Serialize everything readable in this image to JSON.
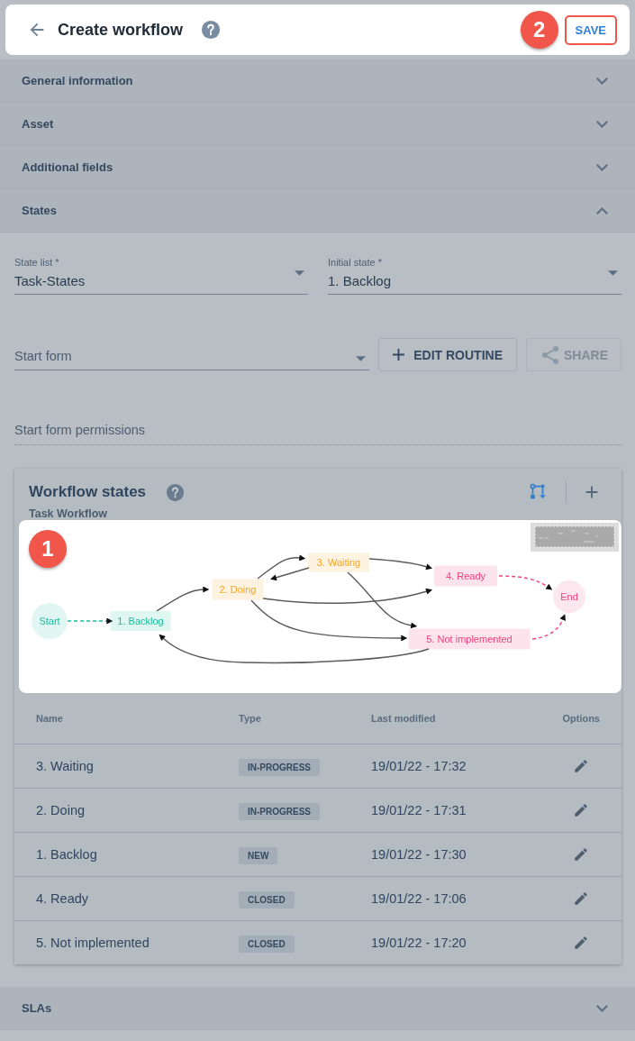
{
  "header": {
    "title": "Create workflow",
    "callout": "2",
    "save_label": "SAVE"
  },
  "sections": [
    {
      "title": "General information",
      "expanded": false
    },
    {
      "title": "Asset",
      "expanded": false
    },
    {
      "title": "Additional fields",
      "expanded": false
    },
    {
      "title": "States",
      "expanded": true,
      "content": {
        "selects": [
          {
            "label": "State list *",
            "value": "Task-States"
          },
          {
            "label": "Initial state *",
            "value": "1. Backlog"
          }
        ],
        "start_form": {
          "placeholder": "Start form"
        },
        "buttons": [
          {
            "label": "EDIT ROUTINE",
            "kind": "add",
            "disabled": false
          },
          {
            "label": "SHARE",
            "kind": "share",
            "disabled": true
          }
        ],
        "permissions": {
          "placeholder": "Start form permissions"
        },
        "card": {
          "title": "Workflow states",
          "subtitle": "Task Workflow",
          "diagram": {
            "callout": "1",
            "nodes": [
              {
                "label": "Start",
                "kind": "circle",
                "color": "#1abc9c"
              },
              {
                "label": "1. Backlog",
                "kind": "box",
                "color": "#1abc9c"
              },
              {
                "label": "2. Doing",
                "kind": "box",
                "color": "#f5a623"
              },
              {
                "label": "3. Waiting",
                "kind": "box",
                "color": "#f5a623"
              },
              {
                "label": "4. Ready",
                "kind": "box",
                "color": "#f0427a"
              },
              {
                "label": "5. Not implemented",
                "kind": "box",
                "color": "#f0427a"
              },
              {
                "label": "End",
                "kind": "circle",
                "color": "#f0427a"
              }
            ]
          },
          "columns": [
            "Name",
            "Type",
            "Last modified",
            "Options"
          ],
          "rows": [
            {
              "name": "3. Waiting",
              "type": "IN-PROGRESS",
              "modified": "19/01/22 - 17:32"
            },
            {
              "name": "2. Doing",
              "type": "IN-PROGRESS",
              "modified": "19/01/22 - 17:31"
            },
            {
              "name": "1. Backlog",
              "type": "NEW",
              "modified": "19/01/22 - 17:30"
            },
            {
              "name": "4. Ready",
              "type": "CLOSED",
              "modified": "19/01/22 - 17:06"
            },
            {
              "name": "5. Not implemented",
              "type": "CLOSED",
              "modified": "19/01/22 - 17:20"
            }
          ]
        }
      }
    },
    {
      "title": "SLAs",
      "expanded": false
    }
  ]
}
